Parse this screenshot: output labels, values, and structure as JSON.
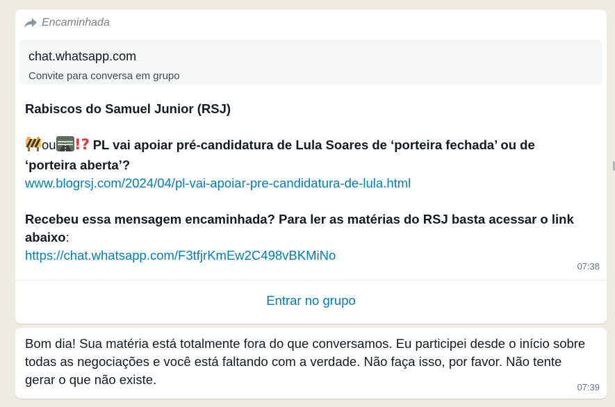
{
  "message1": {
    "forwarded_label": "Encaminhada",
    "preview": {
      "title": "chat.whatsapp.com",
      "description": "Convite para conversa em grupo"
    },
    "group_title": "Rabiscos do Samuel Junior (RSJ)",
    "emoji_between": "ou",
    "headline": "PL vai apoiar pré-candidatura de Lula Soares de ‘porteira fechada’ ou de ‘porteira aberta’?",
    "article_link": "www.blogrsj.com/2024/04/pl-vai-apoiar-pre-candidatura-de-lula.html",
    "cta": "Recebeu essa mensagem encaminhada? Para ler as matérias do RSJ basta acessar o link abaixo",
    "cta_suffix": ":",
    "invite_link": "https://chat.whatsapp.com/F3tfjrKmEw2C498vBKMiNo",
    "time": "07:38",
    "join_button": "Entrar no grupo"
  },
  "message2": {
    "text": "Bom dia! Sua matéria está totalmente fora do que conversamos. Eu participei desde o início sobre todas as negociações e você está faltando com a verdade. Não faça isso, por favor. Não tente gerar o que não existe.",
    "time": "07:39"
  },
  "colors": {
    "background": "#efeae2",
    "bubble": "#ffffff",
    "link": "#027eb5",
    "meta_text": "#667781"
  },
  "icons": {
    "forward": "forward-arrow-icon",
    "emoji1": "construction-sign-emoji",
    "emoji2": "fence-road-emoji",
    "emoji3": "exclamation-question-emoji"
  }
}
